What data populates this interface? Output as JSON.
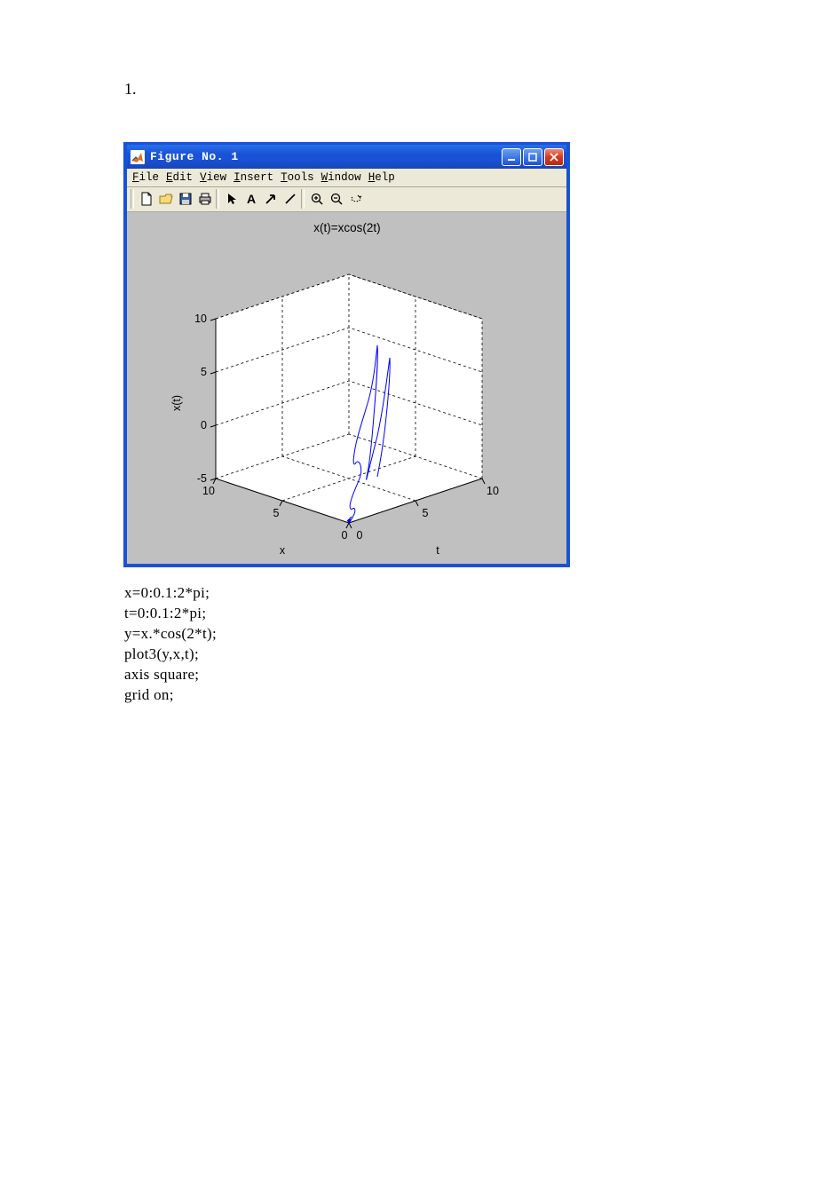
{
  "page_number_label": "1.",
  "figure_window": {
    "title": "Figure No. 1",
    "menus": [
      {
        "mnemonic": "F",
        "rest": "ile"
      },
      {
        "mnemonic": "E",
        "rest": "dit"
      },
      {
        "mnemonic": "V",
        "rest": "iew"
      },
      {
        "mnemonic": "I",
        "rest": "nsert"
      },
      {
        "mnemonic": "T",
        "rest": "ools"
      },
      {
        "mnemonic": "W",
        "rest": "indow"
      },
      {
        "mnemonic": "H",
        "rest": "elp"
      }
    ],
    "toolbar_icons": [
      "new-file-icon",
      "open-file-icon",
      "save-icon",
      "print-icon",
      "arrow-cursor-icon",
      "text-a-icon",
      "arrow-ne-icon",
      "line-icon",
      "zoom-in-icon",
      "zoom-out-icon",
      "rotate-3d-icon"
    ]
  },
  "chart_data": {
    "type": "line3d",
    "title": "x(t)=xcos(2t)",
    "axes": {
      "x": {
        "label": "x",
        "ticks": [
          0,
          5,
          10
        ],
        "range": [
          0,
          10
        ]
      },
      "y": {
        "label": "t",
        "ticks": [
          0,
          5,
          10
        ],
        "range": [
          0,
          10
        ]
      },
      "z": {
        "label": "x(t)",
        "ticks": [
          -5,
          0,
          5,
          10
        ],
        "range": [
          -5,
          10
        ]
      }
    },
    "z_tick_labels": {
      "minus5": "-5",
      "zero": "0",
      "five": "5",
      "ten": "10"
    },
    "xy_tick_labels": {
      "zero": "0",
      "five": "5",
      "ten": "10"
    },
    "generation": {
      "x": "0:0.1:2*pi",
      "t": "0:0.1:2*pi",
      "y_formula": "x.*cos(2*t)"
    },
    "grid": true,
    "axis_mode": "square",
    "legend": false
  },
  "code_lines": [
    "x=0:0.1:2*pi;",
    "t=0:0.1:2*pi;",
    "y=x.*cos(2*t);",
    "plot3(y,x,t);",
    "axis square;",
    "grid on;"
  ]
}
